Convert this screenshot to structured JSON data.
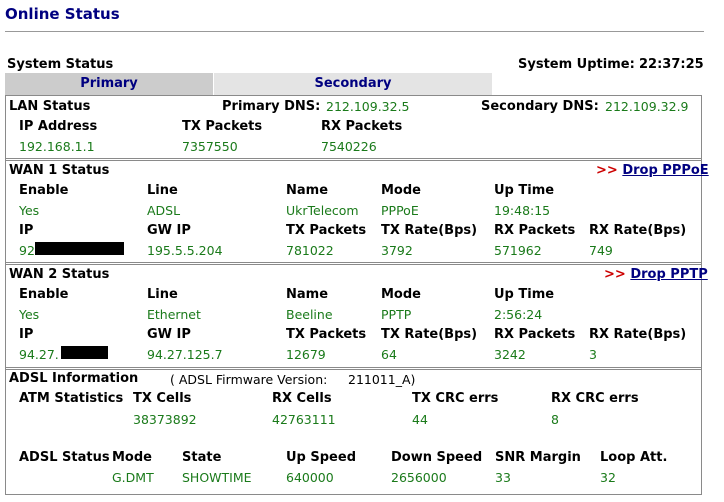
{
  "page": {
    "title": "Online Status"
  },
  "system": {
    "heading": "System Status",
    "uptime_label": "System Uptime:",
    "uptime_value": "22:37:25"
  },
  "tabs": [
    {
      "label": "Primary",
      "active": true
    },
    {
      "label": "Secondary",
      "active": false
    }
  ],
  "lan": {
    "heading": "LAN Status",
    "primary_dns_label": "Primary DNS:",
    "primary_dns": "212.109.32.5",
    "secondary_dns_label": "Secondary DNS:",
    "secondary_dns": "212.109.32.9",
    "columns": [
      "IP Address",
      "TX Packets",
      "RX Packets"
    ],
    "values": [
      "192.168.1.1",
      "7357550",
      "7540226"
    ]
  },
  "wan1": {
    "heading": "WAN 1 Status",
    "action_prefix": ">>",
    "action_label": "Drop PPPoE",
    "row1_labels": [
      "Enable",
      "Line",
      "Name",
      "Mode",
      "Up Time"
    ],
    "row1_values": [
      "Yes",
      "ADSL",
      "UkrTelecom",
      "PPPoE",
      "19:48:15"
    ],
    "row2_labels": [
      "IP",
      "GW IP",
      "TX Packets",
      "TX Rate(Bps)",
      "RX Packets",
      "RX Rate(Bps)"
    ],
    "row2_values": [
      "92",
      "195.5.5.204",
      "781022",
      "3792",
      "571962",
      "749"
    ]
  },
  "wan2": {
    "heading": "WAN 2 Status",
    "action_prefix": ">>",
    "action_label": "Drop PPTP",
    "row1_labels": [
      "Enable",
      "Line",
      "Name",
      "Mode",
      "Up Time"
    ],
    "row1_values": [
      "Yes",
      "Ethernet",
      "Beeline",
      "PPTP",
      "2:56:24"
    ],
    "row2_labels": [
      "IP",
      "GW IP",
      "TX Packets",
      "TX Rate(Bps)",
      "RX Packets",
      "RX Rate(Bps)"
    ],
    "row2_values": [
      "94.27.",
      "94.27.125.7",
      "12679",
      "64",
      "3242",
      "3"
    ]
  },
  "adsl": {
    "heading": "ADSL Information",
    "firmware_label": "( ADSL Firmware Version:",
    "firmware_value": "211011_A)",
    "atm_label": "ATM Statistics",
    "atm_columns": [
      "TX Cells",
      "RX Cells",
      "TX CRC errs",
      "RX CRC errs"
    ],
    "atm_values": [
      "38373892",
      "42763111",
      "44",
      "8"
    ],
    "status_label": "ADSL Status",
    "status_columns": [
      "Mode",
      "State",
      "Up Speed",
      "Down Speed",
      "SNR Margin",
      "Loop Att."
    ],
    "status_values": [
      "G.DMT",
      "SHOWTIME",
      "640000",
      "2656000",
      "33",
      "32"
    ]
  },
  "colors": {
    "title": "#000080",
    "value_green": "#1a7a1a",
    "link_arrow": "#cc0000",
    "border": "#8a8a8a"
  }
}
